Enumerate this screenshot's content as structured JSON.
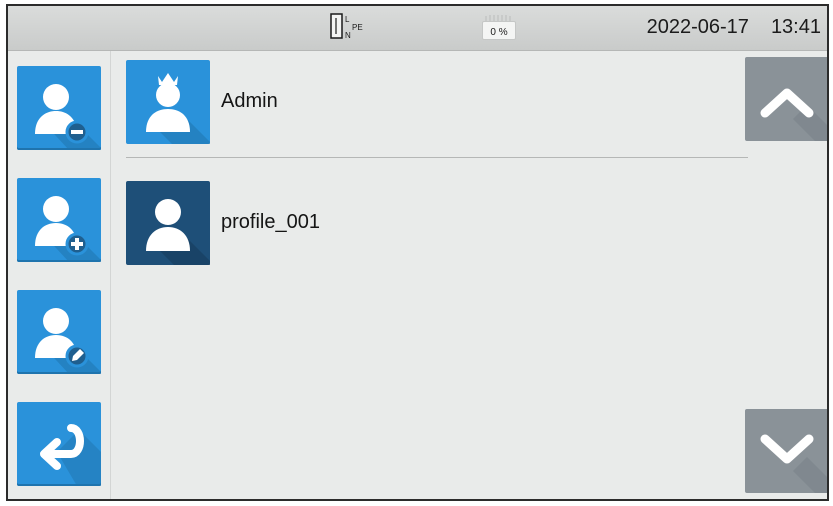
{
  "status_bar": {
    "connection_labels": {
      "l": "L",
      "n": "N",
      "pe": "PE"
    },
    "battery_percent": "0 %",
    "date": "2022-06-17",
    "time": "13:41"
  },
  "sidebar": {
    "buttons": [
      {
        "name": "remove-profile",
        "icon": "user-minus-icon"
      },
      {
        "name": "add-profile",
        "icon": "user-plus-icon"
      },
      {
        "name": "edit-profile",
        "icon": "user-edit-icon"
      },
      {
        "name": "back",
        "icon": "return-arrow-icon"
      }
    ]
  },
  "profiles": [
    {
      "name": "Admin",
      "icon": "user-crown-icon",
      "tile_color": "#2a92da"
    },
    {
      "name": "profile_001",
      "icon": "user-icon",
      "tile_color": "#1e4f78",
      "selected": true
    }
  ],
  "navigation": {
    "up_icon": "chevron-up-icon",
    "down_icon": "chevron-down-icon"
  },
  "colors": {
    "accent": "#2a92da",
    "selected": "#1e4f78",
    "nav": "#8a9298",
    "background": "#e9ebea"
  }
}
